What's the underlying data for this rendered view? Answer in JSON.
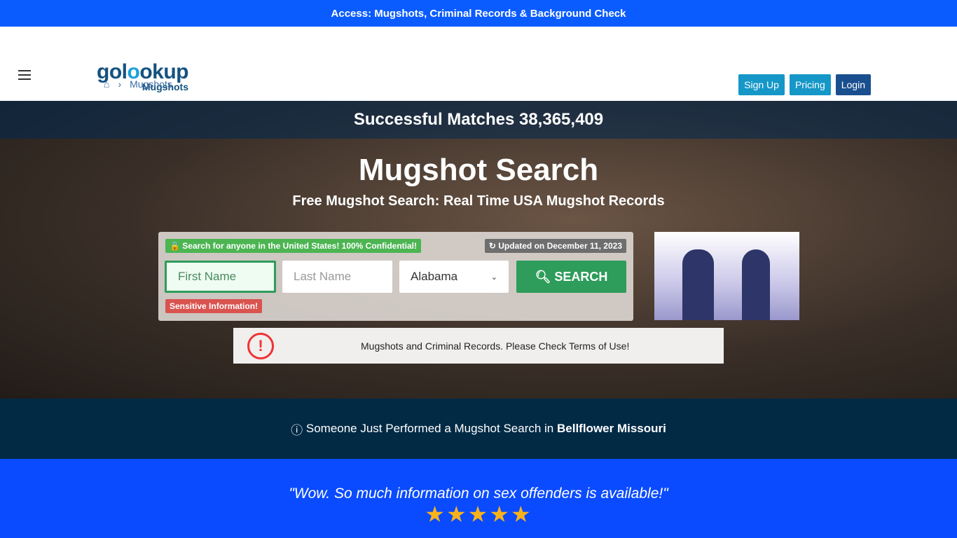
{
  "topbar": {
    "text": "Access: Mugshots, Criminal Records & Background Check"
  },
  "header": {
    "logo_main": "golookup",
    "logo_sub": "Mugshots",
    "signup": "Sign Up",
    "pricing": "Pricing",
    "login": "Login",
    "breadcrumb": "Mugshots"
  },
  "hero": {
    "matches": "Successful Matches 38,365,409",
    "title": "Mugshot Search",
    "subtitle": "Free Mugshot Search: Real Time USA Mugshot Records",
    "confidential": "Search for anyone in the United States! 100% Confidential!",
    "updated": "Updated on December 11, 2023",
    "first_placeholder": "First Name",
    "last_placeholder": "Last Name",
    "state": "Alabama",
    "search": "SEARCH",
    "sensitive": "Sensitive Information!",
    "warning": "Mugshots and Criminal Records. Please Check Terms of Use!"
  },
  "activity": {
    "prefix": "Someone Just Performed a Mugshot Search in",
    "location": "Bellflower Missouri"
  },
  "testimonial": {
    "quote": "\"Wow. So much information on sex offenders is available!\"",
    "rating": 5,
    "stars": "★★★★★"
  },
  "colors": {
    "topbar": "#0a5cff",
    "search": "#2e9c5a",
    "info": "#022a45"
  }
}
